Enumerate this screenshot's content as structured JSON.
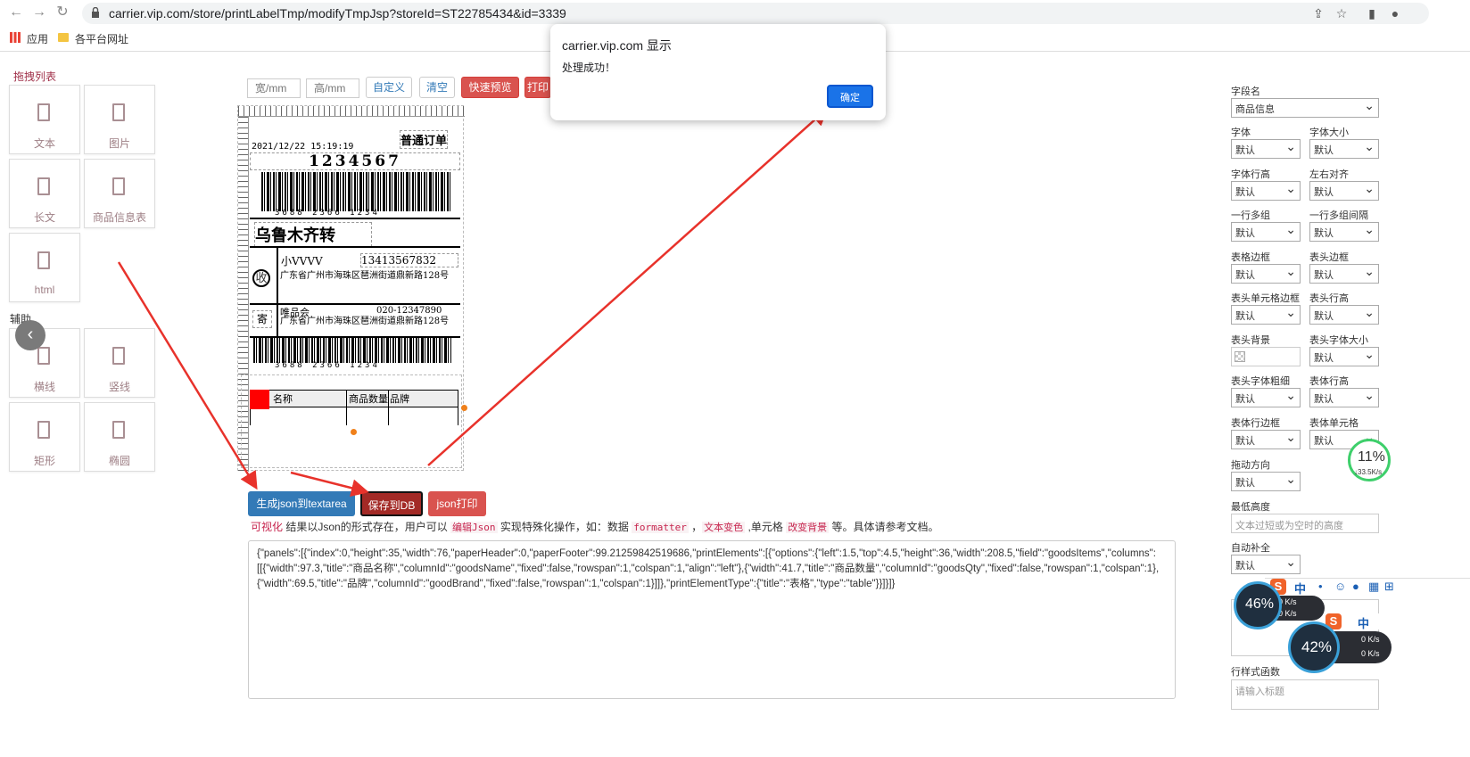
{
  "browser": {
    "url": "carrier.vip.com/store/printLabelTmp/modifyTmpJsp?storeId=ST22785434&id=3339",
    "bookmarks": [
      "应用",
      "各平台网址"
    ]
  },
  "palette": {
    "section_drag": "拖拽列表",
    "items": [
      "文本",
      "图片",
      "长文",
      "商品信息表",
      "html"
    ],
    "section_aux": "辅助",
    "aux_items": [
      "横线",
      "竖线",
      "矩形",
      "椭圆"
    ]
  },
  "toolbar": {
    "width_placeholder": "宽/mm",
    "height_placeholder": "高/mm",
    "custom": "自定义",
    "clear": "清空",
    "preview": "快速预览",
    "print": "打印"
  },
  "label": {
    "order_type": "普通订单",
    "datetime": "2021/12/22 15:19:19",
    "number": "1234567",
    "barcode_digits": "3688 2366 1234",
    "route": "乌鲁木齐转",
    "recv_mark": "收",
    "recv_name": "小VVVV",
    "recv_phone": "13413567832",
    "recv_addr": "广东省广州市海珠区琶洲街道鼎新路128号",
    "send_mark": "寄",
    "send_name": "唯品会",
    "send_phone": "020-12347890",
    "send_addr": "广东省广州市海珠区琶洲街道鼎新路128号",
    "goods_cols": [
      "名称",
      "商品数量",
      "品牌"
    ]
  },
  "actions": {
    "gen_json": "生成json到textarea",
    "save_db": "保存到DB",
    "json_print": "json打印"
  },
  "hint": {
    "t1": "可视化",
    "t2": " 结果以Json的形式存在，用户可以 ",
    "t3": "编辑Json",
    "t4": " 实现特殊化操作，如：数据 ",
    "t5": "formatter",
    "t6": " ，",
    "t7": "文本变色",
    "t8": " ,单元格 ",
    "t9": "改变背景",
    "t10": " 等。具体请参考文档。"
  },
  "json_text": "{\"panels\":[{\"index\":0,\"height\":35,\"width\":76,\"paperHeader\":0,\"paperFooter\":99.21259842519686,\"printElements\":[{\"options\":{\"left\":1.5,\"top\":4.5,\"height\":36,\"width\":208.5,\"field\":\"goodsItems\",\"columns\":[[{\"width\":97.3,\"title\":\"商品名称\",\"columnId\":\"goodsName\",\"fixed\":false,\"rowspan\":1,\"colspan\":1,\"align\":\"left\"},{\"width\":41.7,\"title\":\"商品数量\",\"columnId\":\"goodsQty\",\"fixed\":false,\"rowspan\":1,\"colspan\":1},{\"width\":69.5,\"title\":\"品牌\",\"columnId\":\"goodBrand\",\"fixed\":false,\"rowspan\":1,\"colspan\":1}]]},\"printElementType\":{\"title\":\"表格\",\"type\":\"table\"}}]}]}",
  "panel": {
    "field_label": "字段名",
    "field_value": "商品信息",
    "rows": [
      [
        "字体",
        "字体大小"
      ],
      [
        "字体行高",
        "左右对齐"
      ],
      [
        "一行多组",
        "一行多组间隔"
      ],
      [
        "表格边框",
        "表头边框"
      ],
      [
        "表头单元格边框",
        "表头行高"
      ],
      [
        "表头背景",
        "表头字体大小"
      ],
      [
        "表头字体粗细",
        "表体行高"
      ],
      [
        "表体行边框",
        "表体单元格"
      ]
    ],
    "default": "默认",
    "drag_dir": "拖动方向",
    "min_height": "最低高度",
    "min_height_ph": "文本过短或为空时的高度",
    "auto_fill": "自动补全",
    "row_style": "行样式函数",
    "row_style_ph": "请输入标题"
  },
  "widgets": {
    "gauge1": "11%",
    "gauge1_speed": "↓33.5K/s",
    "gauge2": "46%",
    "gauge2_up": "0 K/s",
    "gauge2_down": "0 K/s",
    "gauge3": "42%",
    "gauge3_up": "0 K/s",
    "gauge3_down": "0 K/s",
    "ime": "中"
  },
  "dialog": {
    "title": "carrier.vip.com 显示",
    "message": "处理成功！",
    "ok": "确定"
  },
  "colors": {
    "danger": "#d9534f",
    "primary": "#337ab7",
    "dialog_button": "#1a73e8",
    "arrow": "#e8322b"
  }
}
